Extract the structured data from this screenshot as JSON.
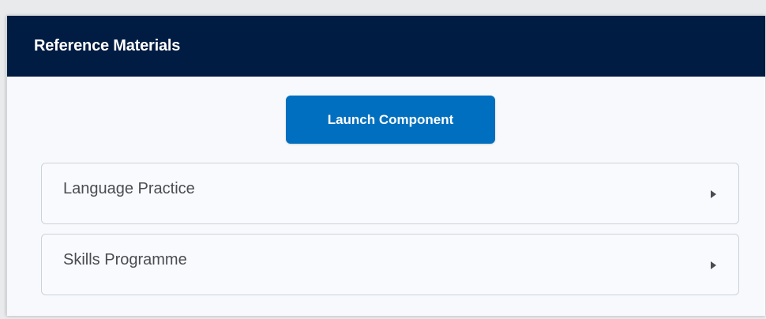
{
  "widget": {
    "title": "Reference Materials",
    "launch_button_label": "Launch Component",
    "items": [
      {
        "label": "Language Practice",
        "icon": "caret-right-icon"
      },
      {
        "label": "Skills Programme",
        "icon": "caret-right-icon"
      }
    ]
  },
  "colors": {
    "header_bg": "#011c42",
    "button_bg": "#006fbf",
    "panel_bg": "#f7f9fc"
  }
}
